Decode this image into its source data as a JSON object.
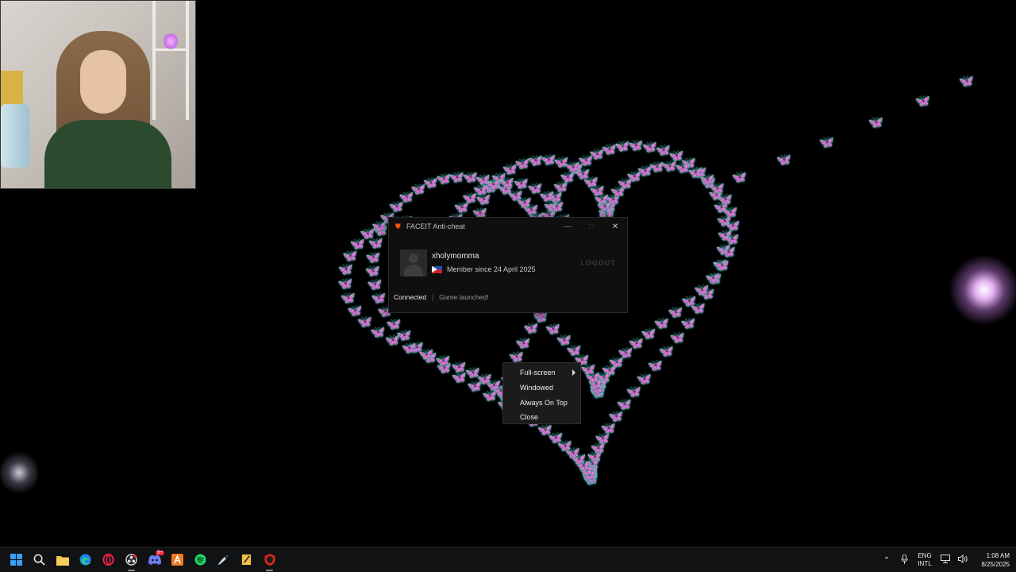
{
  "faceit": {
    "title": "FACEIT Anti-cheat",
    "username": "xholymomma",
    "member_since": "Member since 24 April 2025",
    "logout": "LOGOUT",
    "status_connected": "Connected",
    "status_game": "Game launched!",
    "accent_color": "#ff5500"
  },
  "context_menu": {
    "items": [
      {
        "label": "Full-screen",
        "has_submenu": true
      },
      {
        "label": "Windowed",
        "has_submenu": false
      },
      {
        "label": "Always On Top",
        "has_submenu": false
      },
      {
        "label": "Close",
        "has_submenu": false
      }
    ]
  },
  "overlay": {
    "butterfly_color": "#e8a4ee"
  },
  "taskbar": {
    "icons": [
      "windows-start-icon",
      "search-icon",
      "file-explorer-icon",
      "edge-icon",
      "opera-gx-icon",
      "obs-icon",
      "discord-icon",
      "app-a-icon",
      "spotify-icon",
      "steam-icon",
      "app-notes-icon",
      "faceit-icon"
    ],
    "discord_badge": "9+",
    "lang_top": "ENG",
    "lang_bottom": "INTL",
    "time": "1:08 AM",
    "date": "8/25/2025"
  }
}
